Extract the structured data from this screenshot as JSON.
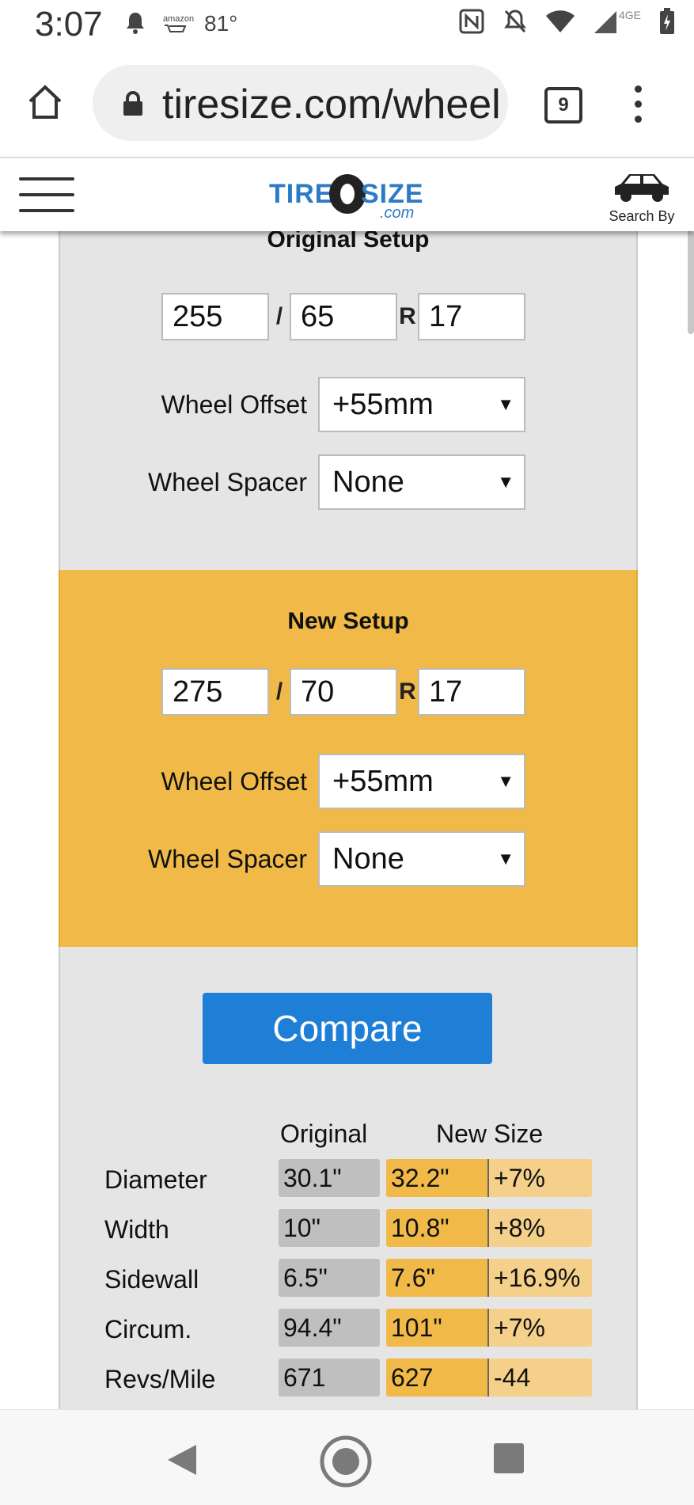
{
  "status_bar": {
    "time": "3:07",
    "amazon_label": "amazon",
    "temperature": "81°",
    "network": "4GE"
  },
  "browser": {
    "url": "tiresize.com/wheel",
    "tab_count": "9"
  },
  "site_header": {
    "logo_tire": "TIRE",
    "logo_size": "SIZE",
    "logo_com": ".com",
    "search_by_label": "Search By"
  },
  "original_setup": {
    "title": "Original Setup",
    "width": "255",
    "aspect": "65",
    "rim": "17",
    "slash": "/",
    "r_label": "R",
    "offset_label": "Wheel Offset",
    "offset_value": "+55mm",
    "spacer_label": "Wheel Spacer",
    "spacer_value": "None"
  },
  "new_setup": {
    "title": "New Setup",
    "width": "275",
    "aspect": "70",
    "rim": "17",
    "slash": "/",
    "r_label": "R",
    "offset_label": "Wheel Offset",
    "offset_value": "+55mm",
    "spacer_label": "Wheel Spacer",
    "spacer_value": "None"
  },
  "compare_button": "Compare",
  "results": {
    "headers": {
      "original": "Original",
      "new_size": "New Size"
    },
    "rows": [
      {
        "label": "Diameter",
        "original": "30.1\"",
        "new": "32.2\"",
        "diff": "+7%"
      },
      {
        "label": "Width",
        "original": "10\"",
        "new": "10.8\"",
        "diff": "+8%"
      },
      {
        "label": "Sidewall",
        "original": "6.5\"",
        "new": "7.6\"",
        "diff": "+16.9%"
      },
      {
        "label": "Circum.",
        "original": "94.4\"",
        "new": "101\"",
        "diff": "+7%"
      },
      {
        "label": "Revs/Mile",
        "original": "671",
        "new": "627",
        "diff": "-44"
      }
    ]
  },
  "colors": {
    "accent_yellow": "#f1ba48",
    "button_blue": "#1f7fd6",
    "panel_gray": "#e5e5e5"
  }
}
